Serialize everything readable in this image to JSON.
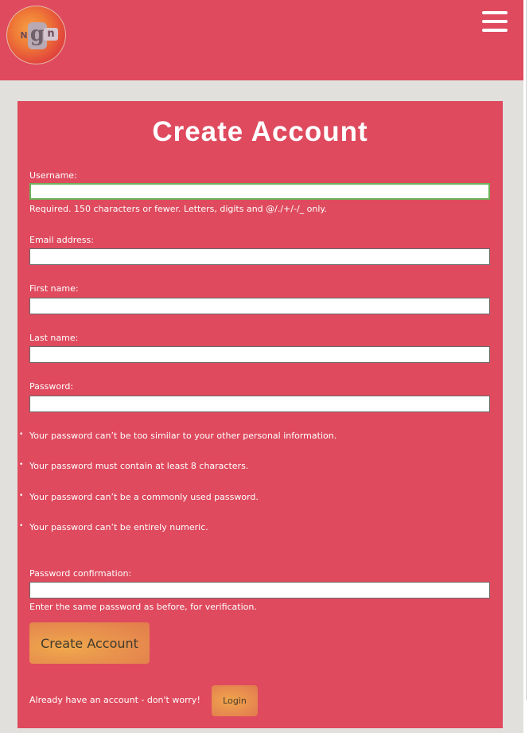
{
  "header": {
    "logo_letters": {
      "g": "g",
      "n": "n",
      "m": "N"
    },
    "menu_icon": "hamburger-menu-icon"
  },
  "form": {
    "title": "Create Account",
    "username": {
      "label": "Username:",
      "value": "",
      "help": "Required. 150 characters or fewer. Letters, digits and @/./+/-/_ only."
    },
    "email": {
      "label": "Email address:",
      "value": ""
    },
    "first_name": {
      "label": "First name:",
      "value": ""
    },
    "last_name": {
      "label": "Last name:",
      "value": ""
    },
    "password": {
      "label": "Password:",
      "value": "",
      "rules": [
        "Your password can’t be too similar to your other personal information.",
        "Your password must contain at least 8 characters.",
        "Your password can’t be a commonly used password.",
        "Your password can’t be entirely numeric."
      ]
    },
    "password_confirmation": {
      "label": "Password confirmation:",
      "value": "",
      "help": "Enter the same password as before, for verification."
    },
    "submit_label": "Create Account",
    "login_prompt": "Already have an account - don't worry!",
    "login_label": "Login"
  },
  "colors": {
    "accent": "#df4a5e",
    "background": "#e1e0dc",
    "focus": "#6db35a",
    "button": "#e9954d"
  }
}
